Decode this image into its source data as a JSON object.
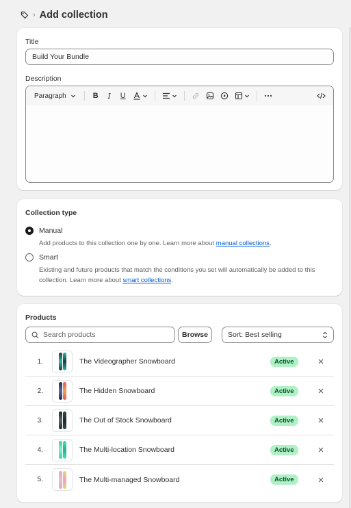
{
  "header": {
    "title": "Add collection",
    "breadcrumb_icon": "tag-icon"
  },
  "general": {
    "title_label": "Title",
    "title_value": "Build Your Bundle",
    "description_label": "Description",
    "editor": {
      "paragraph_label": "Paragraph"
    }
  },
  "collection_type": {
    "title": "Collection type",
    "options": [
      {
        "label": "Manual",
        "selected": true,
        "help_prefix": "Add products to this collection one by one. Learn more about ",
        "help_link": "manual collections",
        "help_suffix": "."
      },
      {
        "label": "Smart",
        "selected": false,
        "help_prefix": "Existing and future products that match the conditions you set will automatically be added to this collection. Learn more about ",
        "help_link": "smart collections",
        "help_suffix": "."
      }
    ]
  },
  "products": {
    "title": "Products",
    "search_placeholder": "Search products",
    "browse_label": "Browse",
    "sort_label": "Sort: Best selling",
    "items": [
      {
        "index": "1.",
        "name": "The Videographer Snowboard",
        "status": "Active",
        "colors": [
          "#1f3b3a",
          "#2fb8a8"
        ]
      },
      {
        "index": "2.",
        "name": "The Hidden Snowboard",
        "status": "Active",
        "colors": [
          "#2a2a3a",
          "#e85a5a"
        ]
      },
      {
        "index": "3.",
        "name": "The Out of Stock Snowboard",
        "status": "Active",
        "colors": [
          "#1b2a2a",
          "#3a4a4a"
        ]
      },
      {
        "index": "4.",
        "name": "The Multi-location Snowboard",
        "status": "Active",
        "colors": [
          "#3ad1a8",
          "#4ae0b5"
        ]
      },
      {
        "index": "5.",
        "name": "The Multi-managed Snowboard",
        "status": "Active",
        "colors": [
          "#f0a0c0",
          "#d8e070"
        ]
      }
    ]
  },
  "colors": {
    "accent_link": "#005bd3",
    "badge_bg": "#aff1c4",
    "badge_text": "#0c5132",
    "page_bg": "#f1f1f1"
  }
}
